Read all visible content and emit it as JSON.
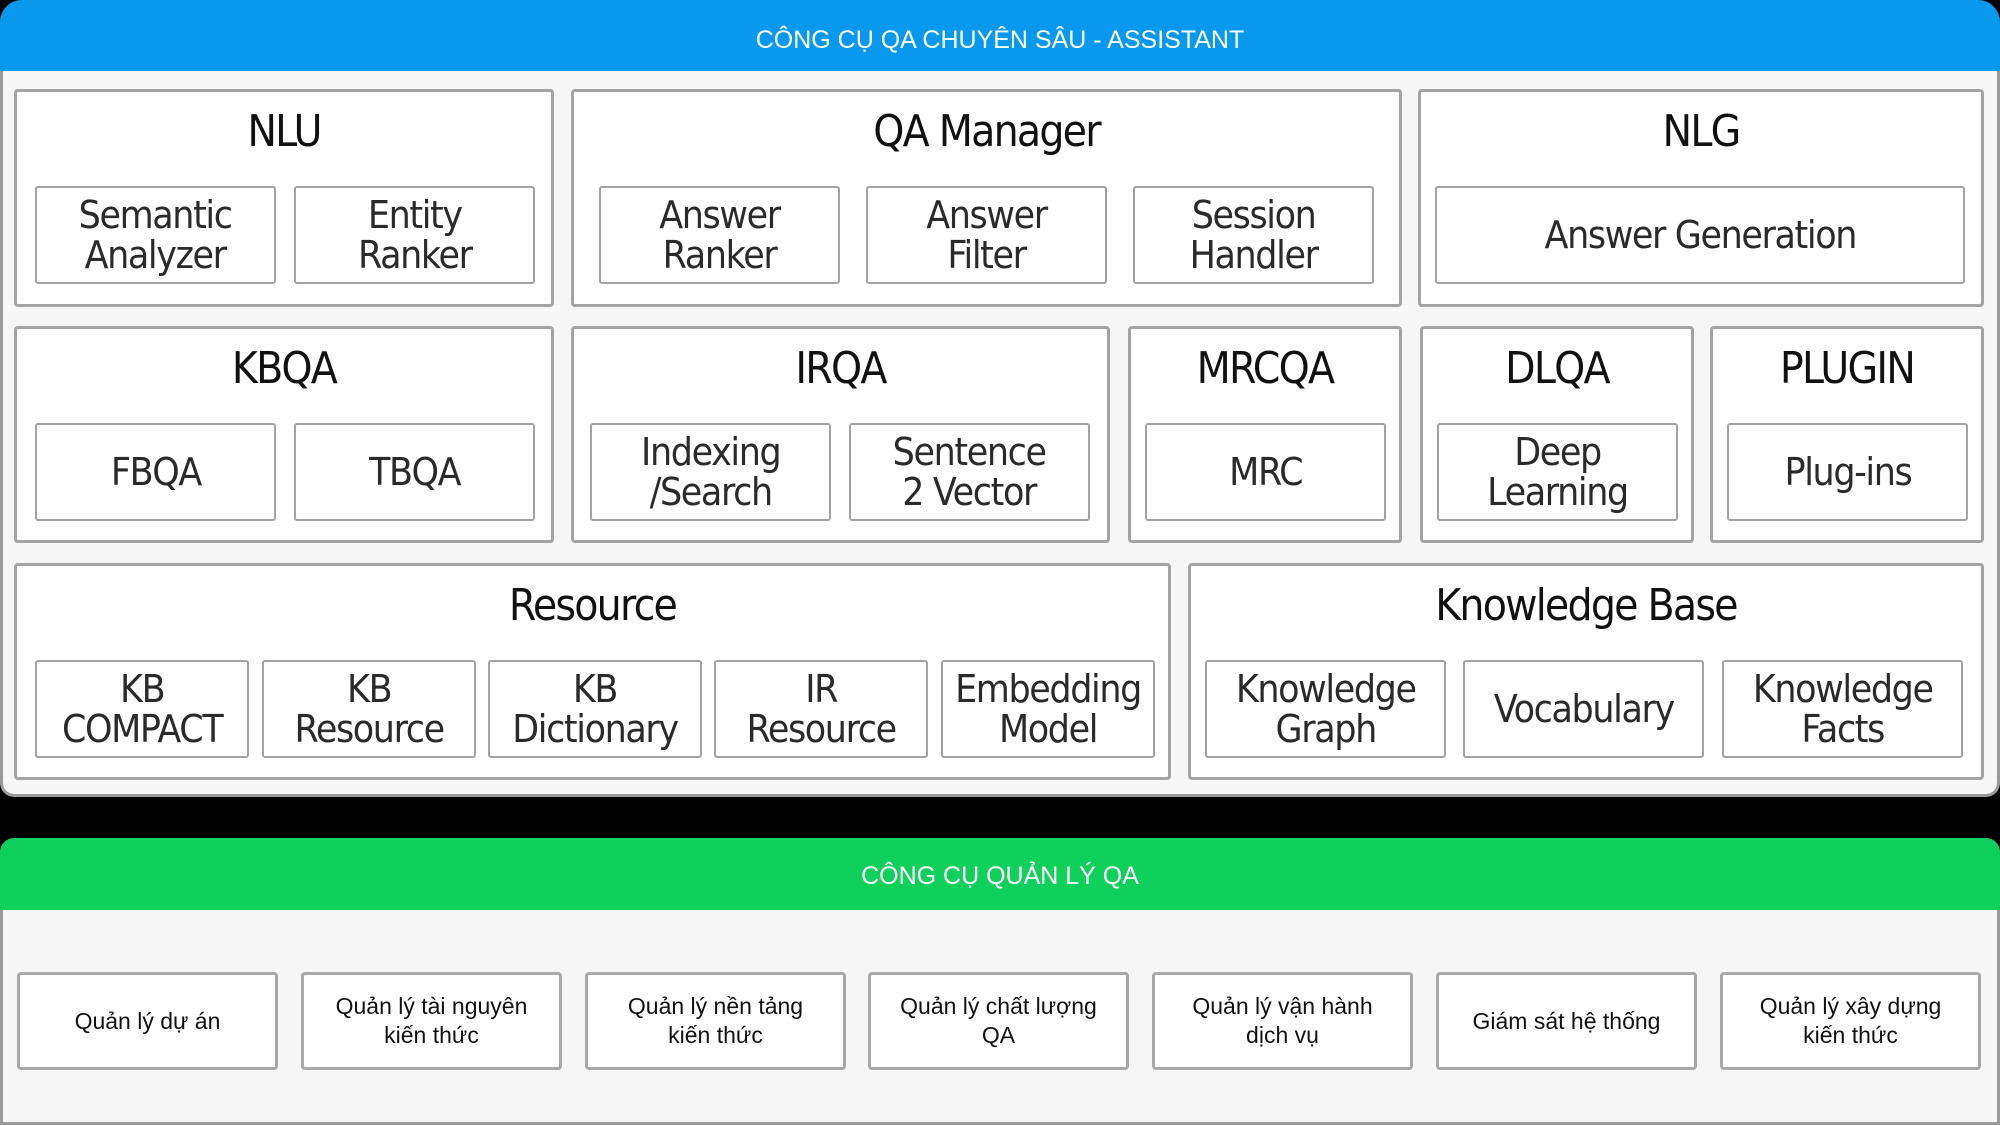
{
  "top_section": {
    "title": "CÔNG CỤ QA CHUYÊN SÂU - ASSISTANT",
    "header_color": "#0899EF",
    "groups": [
      {
        "name": "NLU",
        "items": [
          "Semantic\nAnalyzer",
          "Entity\nRanker"
        ]
      },
      {
        "name": "QA Manager",
        "items": [
          "Answer\nRanker",
          "Answer\nFilter",
          "Session\nHandler"
        ]
      },
      {
        "name": "NLG",
        "items": [
          "Answer Generation"
        ]
      },
      {
        "name": "KBQA",
        "items": [
          "FBQA",
          "TBQA"
        ]
      },
      {
        "name": "IRQA",
        "items": [
          "Indexing\n/Search",
          "Sentence\n2 Vector"
        ]
      },
      {
        "name": "MRCQA",
        "items": [
          "MRC"
        ]
      },
      {
        "name": "DLQA",
        "items": [
          "Deep\nLearning"
        ]
      },
      {
        "name": "PLUGIN",
        "items": [
          "Plug-ins"
        ]
      },
      {
        "name": "Resource",
        "items": [
          "KB\nCOMPACT",
          "KB\nResource",
          "KB\nDictionary",
          "IR\nResource",
          "Embedding\nModel"
        ]
      },
      {
        "name": "Knowledge Base",
        "items": [
          "Knowledge\nGraph",
          "Vocabulary",
          "Knowledge\nFacts"
        ]
      }
    ]
  },
  "bottom_section": {
    "title": "CÔNG CỤ QUẢN LÝ QA",
    "header_color": "#0FD05A",
    "items": [
      "Quản lý dự án",
      "Quản lý tài nguyên\nkiến thức",
      "Quản lý nền tảng\nkiến thức",
      "Quản lý chất lượng\nQA",
      "Quản lý vận hành\ndịch vụ",
      "Giám sát hệ thống",
      "Quản lý xây dựng\nkiến thức"
    ]
  }
}
